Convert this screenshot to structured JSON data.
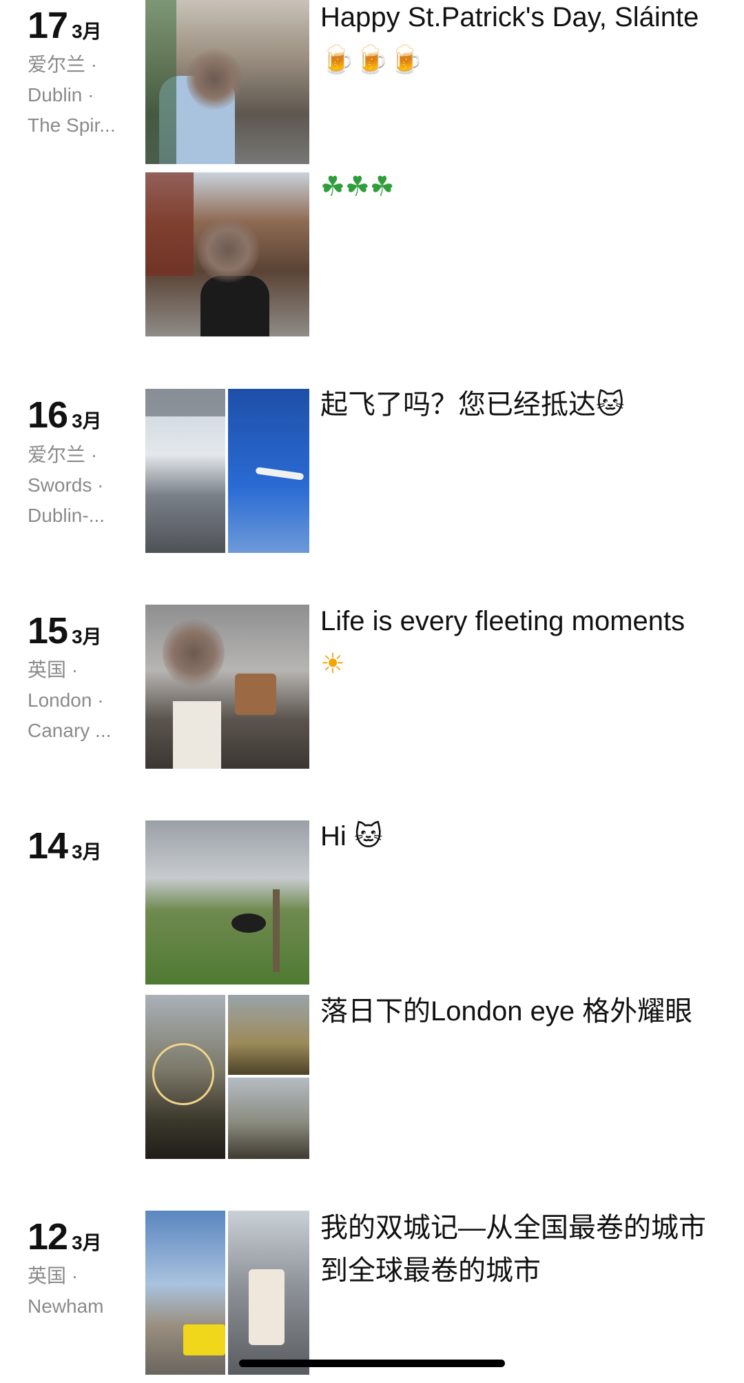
{
  "posts": [
    {
      "day": "17",
      "month": "3月",
      "location": [
        "爱尔兰 ·",
        "Dublin ·",
        "The Spir..."
      ],
      "entries": [
        {
          "caption": "Happy St.Patrick's Day, Sláinte",
          "emoji": "🍺🍺🍺"
        },
        {
          "caption": "",
          "emoji": "☘☘☘"
        }
      ]
    },
    {
      "day": "16",
      "month": "3月",
      "location": [
        "爱尔兰 ·",
        "Swords ·",
        "Dublin-..."
      ],
      "entries": [
        {
          "caption": "起飞了吗？您已经抵达",
          "emoji": "🐱"
        }
      ]
    },
    {
      "day": "15",
      "month": "3月",
      "location": [
        "英国 ·",
        "London ·",
        "Canary ..."
      ],
      "entries": [
        {
          "caption": "Life is every fleeting moments",
          "emoji": "☀"
        }
      ]
    },
    {
      "day": "14",
      "month": "3月",
      "location": [],
      "entries": [
        {
          "caption": "Hi",
          "emoji": "🐱"
        },
        {
          "caption": "落日下的London eye 格外耀眼",
          "emoji": ""
        }
      ]
    },
    {
      "day": "12",
      "month": "3月",
      "location": [
        "英国 ·",
        "Newham"
      ],
      "entries": [
        {
          "caption": "我的双城记—从全国最卷的城市到全球最卷的城市",
          "emoji": ""
        }
      ]
    }
  ],
  "colors": {
    "text": "#111111",
    "secondary": "#8a8a8a",
    "background": "#ffffff"
  }
}
